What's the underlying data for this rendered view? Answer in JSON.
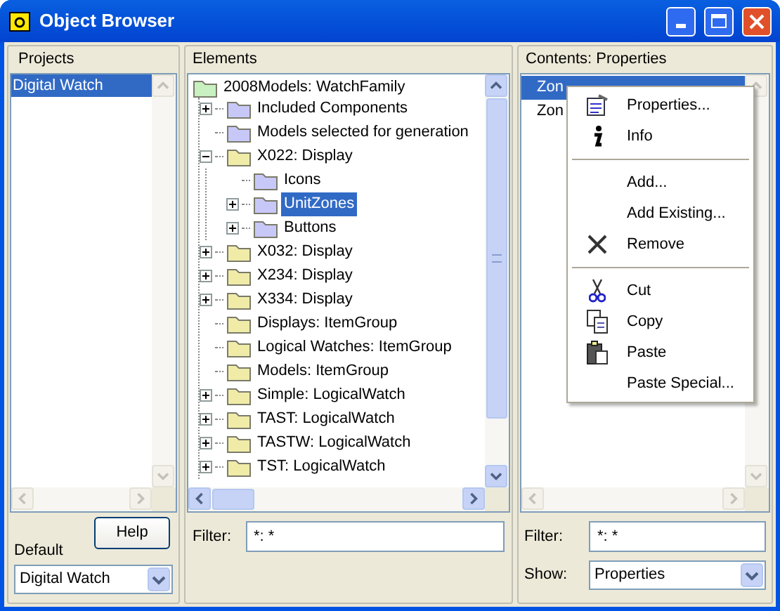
{
  "window": {
    "title": "Object Browser"
  },
  "projects": {
    "header": "Projects",
    "items": [
      {
        "label": "Digital Watch",
        "selected": true
      }
    ],
    "help_button": "Help",
    "default_label": "Default",
    "default_value": "Digital Watch"
  },
  "elements": {
    "header": "Elements",
    "tree": [
      {
        "label": "2008Models: WatchFamily",
        "color": "#c8f0c0",
        "selected": false,
        "children": [
          {
            "label": "Included Components",
            "kind": "collapsed",
            "color": "#c8c8f8",
            "selected": false
          },
          {
            "label": "Models selected for generation",
            "kind": "leaf",
            "color": "#c8c8f8",
            "selected": false
          },
          {
            "label": "X022: Display",
            "kind": "expanded",
            "color": "#f0eca8",
            "selected": false,
            "children": [
              {
                "label": "Icons",
                "kind": "leaf",
                "color": "#c8c8f8",
                "selected": false
              },
              {
                "label": "UnitZones",
                "kind": "collapsed",
                "color": "#c8c8f8",
                "selected": true
              },
              {
                "label": "Buttons",
                "kind": "collapsed",
                "color": "#c8c8f8",
                "selected": false
              }
            ]
          },
          {
            "label": "X032: Display",
            "kind": "collapsed",
            "color": "#f0eca8",
            "selected": false
          },
          {
            "label": "X234: Display",
            "kind": "collapsed",
            "color": "#f0eca8",
            "selected": false
          },
          {
            "label": "X334: Display",
            "kind": "collapsed",
            "color": "#f0eca8",
            "selected": false
          },
          {
            "label": "Displays: ItemGroup",
            "kind": "leaf",
            "color": "#f0eca8",
            "selected": false
          },
          {
            "label": "Logical Watches: ItemGroup",
            "kind": "leaf",
            "color": "#f0eca8",
            "selected": false
          },
          {
            "label": "Models: ItemGroup",
            "kind": "leaf",
            "color": "#f0eca8",
            "selected": false
          },
          {
            "label": "Simple: LogicalWatch",
            "kind": "collapsed",
            "color": "#f0eca8",
            "selected": false
          },
          {
            "label": "TAST: LogicalWatch",
            "kind": "collapsed",
            "color": "#f0eca8",
            "selected": false
          },
          {
            "label": "TASTW: LogicalWatch",
            "kind": "collapsed",
            "color": "#f0eca8",
            "selected": false
          },
          {
            "label": "TST: LogicalWatch",
            "kind": "collapsed",
            "color": "#f0eca8",
            "selected": false
          }
        ]
      }
    ],
    "filter_label": "Filter:",
    "filter_value": "*: *"
  },
  "contents": {
    "header": "Contents: Properties",
    "items": [
      {
        "label": "Zon",
        "selected": true
      },
      {
        "label": "Zon",
        "selected": false
      }
    ],
    "filter_label": "Filter:",
    "filter_value": "*: *",
    "show_label": "Show:",
    "show_value": "Properties"
  },
  "context_menu": [
    {
      "kind": "properties",
      "label": "Properties..."
    },
    {
      "kind": "info",
      "label": "Info"
    },
    {
      "kind": "separator"
    },
    {
      "kind": "plain",
      "label": "Add..."
    },
    {
      "kind": "plain",
      "label": "Add Existing..."
    },
    {
      "kind": "remove",
      "label": "Remove"
    },
    {
      "kind": "separator"
    },
    {
      "kind": "cut",
      "label": "Cut"
    },
    {
      "kind": "copy",
      "label": "Copy"
    },
    {
      "kind": "paste",
      "label": "Paste"
    },
    {
      "kind": "plain",
      "label": "Paste Special..."
    }
  ]
}
